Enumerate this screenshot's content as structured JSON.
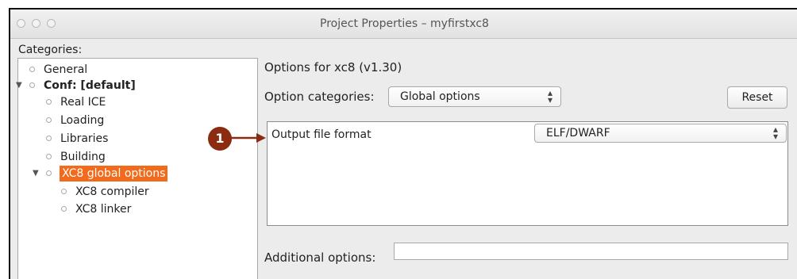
{
  "window": {
    "title": "Project Properties – myfirstxc8"
  },
  "categories": {
    "label": "Categories:",
    "items": [
      {
        "label": "General"
      },
      {
        "label": "Conf: [default]"
      },
      {
        "label": "Real ICE"
      },
      {
        "label": "Loading"
      },
      {
        "label": "Libraries"
      },
      {
        "label": "Building"
      },
      {
        "label": "XC8 global options"
      },
      {
        "label": "XC8 compiler"
      },
      {
        "label": "XC8 linker"
      }
    ]
  },
  "options": {
    "title": "Options for xc8 (v1.30)",
    "category_label": "Option categories:",
    "category_value": "Global options",
    "reset_label": "Reset",
    "output_format_label": "Output file format",
    "output_format_value": "ELF/DWARF",
    "additional_label": "Additional options:",
    "additional_value": ""
  },
  "callout": {
    "number": "1",
    "color": "#8b2b12"
  },
  "colors": {
    "selection": "#f26a1b"
  }
}
